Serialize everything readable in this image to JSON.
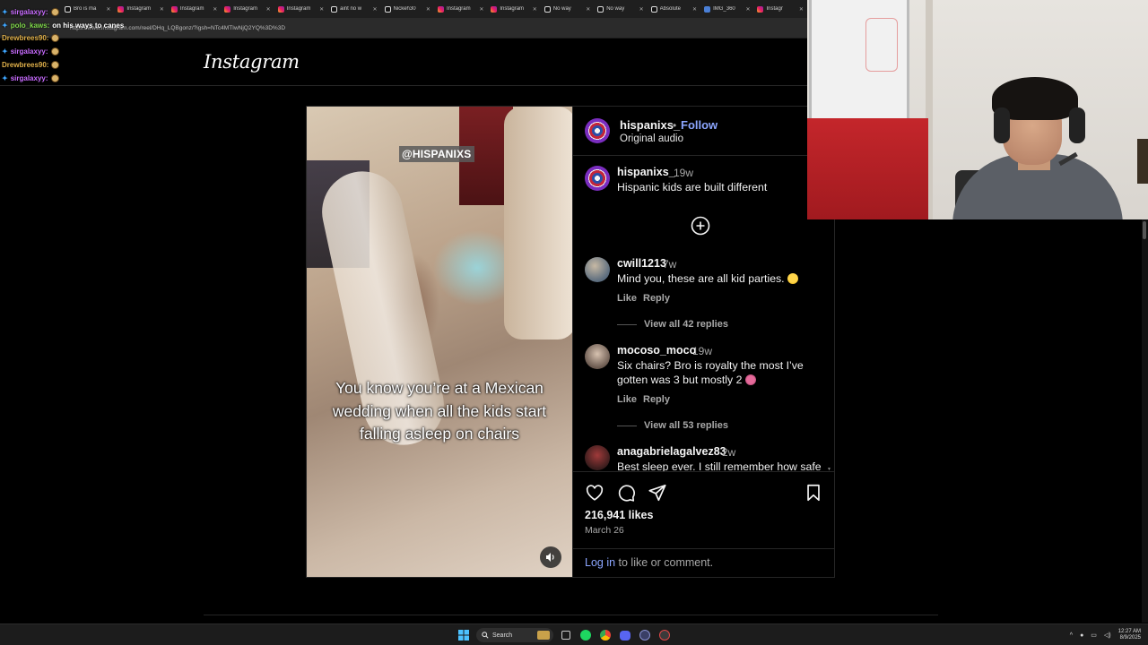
{
  "browser": {
    "tabs": [
      {
        "label": "Bro is ma",
        "favicon": "tiktok-icon"
      },
      {
        "label": "Instagram",
        "favicon": "instagram-icon"
      },
      {
        "label": "Instagram",
        "favicon": "instagram-icon"
      },
      {
        "label": "Instagram",
        "favicon": "instagram-icon"
      },
      {
        "label": "Instagram",
        "favicon": "instagram-icon"
      },
      {
        "label": "aint no w",
        "favicon": "tiktok-icon"
      },
      {
        "label": "Nickeh30",
        "favicon": "tiktok-icon"
      },
      {
        "label": "Instagram",
        "favicon": "instagram-icon"
      },
      {
        "label": "Instagram",
        "favicon": "instagram-icon"
      },
      {
        "label": "No way",
        "favicon": "tiktok-icon"
      },
      {
        "label": "No way",
        "favicon": "tiktok-icon"
      },
      {
        "label": "Absolute",
        "favicon": "tiktok-icon"
      },
      {
        "label": "IMG_360",
        "favicon": "image-icon"
      },
      {
        "label": "Instagr",
        "favicon": "instagram-icon"
      }
    ],
    "url": "https://www.instagram.com/reel/DHq_LQBgonz/?igsh=NTc4MTIwNjQ2YQ%3D%3D"
  },
  "chat": [
    {
      "user": "sirgalaxyy:",
      "color": "#c86bff",
      "message": "",
      "badge": true
    },
    {
      "user": "polo_kaws:",
      "color": "#7fd84a",
      "message": "on his ways to canes",
      "badge": true
    },
    {
      "user": "Drewbrees90:",
      "color": "#e0b04a",
      "message": "",
      "badge": false
    },
    {
      "user": "sirgalaxyy:",
      "color": "#c86bff",
      "message": "",
      "badge": true
    },
    {
      "user": "Drewbrees90:",
      "color": "#e0b04a",
      "message": "",
      "badge": false
    },
    {
      "user": "sirgalaxyy:",
      "color": "#c86bff",
      "message": "",
      "badge": true
    }
  ],
  "instagram": {
    "logo": "Instagram",
    "post": {
      "watermark": "@HISPANIXS",
      "video_caption": "You know you’re at a Mexican wedding when all the kids start falling asleep on chairs",
      "author": "hispanixs_",
      "dot": "•",
      "follow_label": "Follow",
      "audio": "Original audio",
      "caption": {
        "user": "hispanixs_",
        "time": "19w",
        "text": "Hispanic kids are built different"
      },
      "comments": [
        {
          "user": "cwill1213",
          "time": "7w",
          "text": "Mind you, these are all kid parties.",
          "emoji": "laugh-emoji",
          "like": "Like",
          "reply": "Reply",
          "replies": "View all 42 replies"
        },
        {
          "user": "mocoso_moco",
          "time": "19w",
          "text": "Six chairs? Bro is royalty the most I’ve gotten was 3 but mostly 2",
          "emoji": "eyes-emoji",
          "like": "Like",
          "reply": "Reply",
          "replies": "View all 53 replies"
        },
        {
          "user": "anagabrielagalvez83",
          "time": "2w",
          "text": "Best sleep ever. I still remember how safe"
        }
      ],
      "likes": "216,941 likes",
      "date": "March 26",
      "login_link": "Log in",
      "login_suffix": " to like or comment."
    }
  },
  "taskbar": {
    "search_label": "Search",
    "time": "12:27 AM",
    "date": "8/9/2025"
  }
}
